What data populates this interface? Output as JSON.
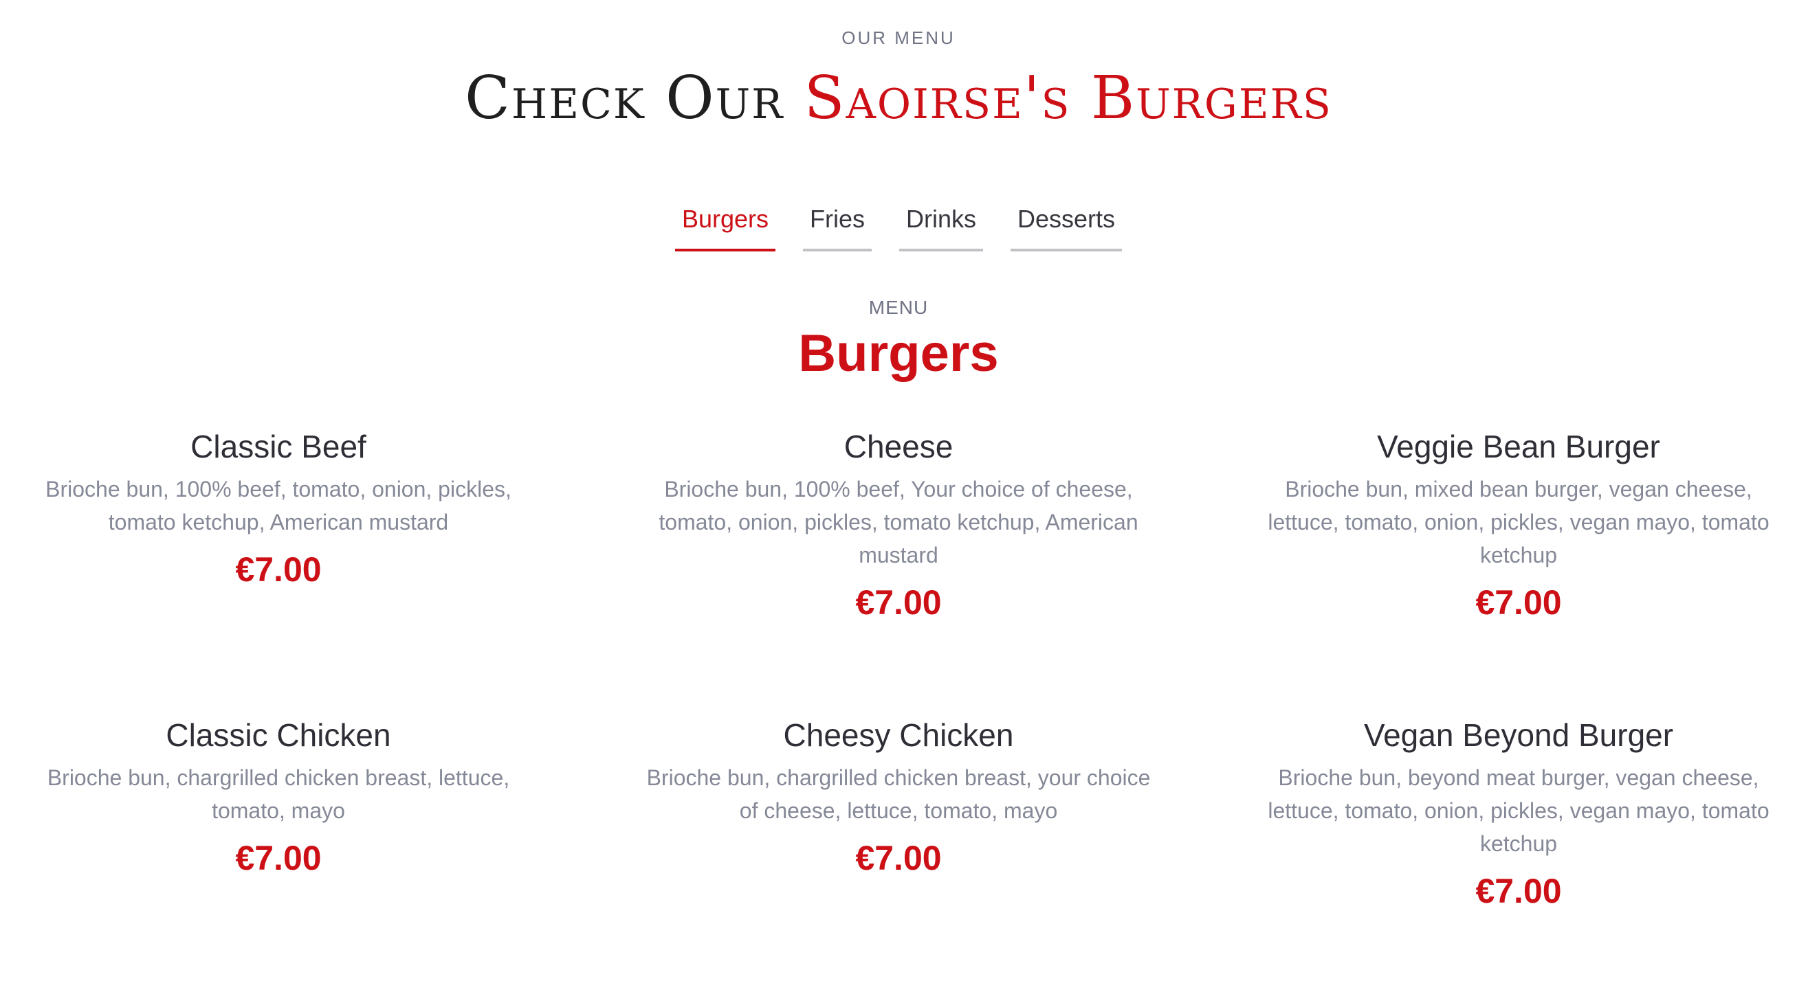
{
  "header": {
    "eyebrow": "OUR MENU",
    "title_prefix": "Check Our",
    "title_accent": "Saoirse's Burgers"
  },
  "tabs": [
    {
      "label": "Burgers",
      "active": true
    },
    {
      "label": "Fries",
      "active": false
    },
    {
      "label": "Drinks",
      "active": false
    },
    {
      "label": "Desserts",
      "active": false
    }
  ],
  "section": {
    "eyebrow": "MENU",
    "title": "Burgers"
  },
  "items": [
    {
      "name": "Classic Beef",
      "description": "Brioche bun, 100% beef, tomato, onion, pickles, tomato ketchup, American mustard",
      "price": "€7.00"
    },
    {
      "name": "Cheese",
      "description": "Brioche bun, 100% beef, Your choice of cheese, tomato, onion, pickles, tomato ketchup, American mustard",
      "price": "€7.00"
    },
    {
      "name": "Veggie Bean Burger",
      "description": "Brioche bun, mixed bean burger, vegan cheese, lettuce, tomato, onion, pickles, vegan mayo, tomato ketchup",
      "price": "€7.00"
    },
    {
      "name": "Classic Chicken",
      "description": "Brioche bun, chargrilled chicken breast, lettuce, tomato, mayo",
      "price": "€7.00"
    },
    {
      "name": "Cheesy Chicken",
      "description": "Brioche bun, chargrilled chicken breast, your choice of cheese, lettuce, tomato, mayo",
      "price": "€7.00"
    },
    {
      "name": "Vegan Beyond Burger",
      "description": "Brioche bun, beyond meat burger, vegan cheese, lettuce, tomato, onion, pickles, vegan mayo, tomato ketchup",
      "price": "€7.00"
    }
  ],
  "colors": {
    "accent": "#cc1016",
    "text": "#37373f",
    "muted": "#858997",
    "tab_underline": "#c1c1c6"
  }
}
